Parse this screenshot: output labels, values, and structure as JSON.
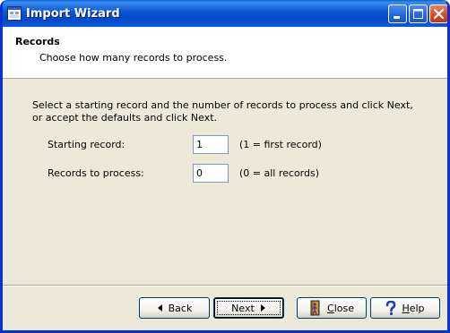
{
  "window": {
    "title": "Import Wizard"
  },
  "header": {
    "title": "Records",
    "subtitle": "Choose how many records to process."
  },
  "body": {
    "instructions": "Select a starting record and the number of records to process and click Next, or accept the defaults and click Next.",
    "fields": [
      {
        "label": "Starting record:",
        "value": "1",
        "hint": "(1 = first record)"
      },
      {
        "label": "Records to process:",
        "value": "0",
        "hint": "(0 = all records)"
      }
    ]
  },
  "footer": {
    "back_label": "Back",
    "next_label": "Next",
    "close_label_pre": "",
    "close_label_u": "C",
    "close_label_post": "lose",
    "help_label_pre": "",
    "help_label_u": "H",
    "help_label_post": "elp"
  },
  "colors": {
    "titlebar": "#0a55d0",
    "dialog_bg": "#ece9d8",
    "header_bg": "#ffffff"
  },
  "icons": {
    "app": "wizard-window-icon",
    "minimize": "minimize-icon",
    "maximize": "maximize-icon",
    "close": "close-icon",
    "back": "triangle-left-icon",
    "next": "triangle-right-icon",
    "close_button": "door-exit-icon",
    "help": "question-mark-icon"
  }
}
